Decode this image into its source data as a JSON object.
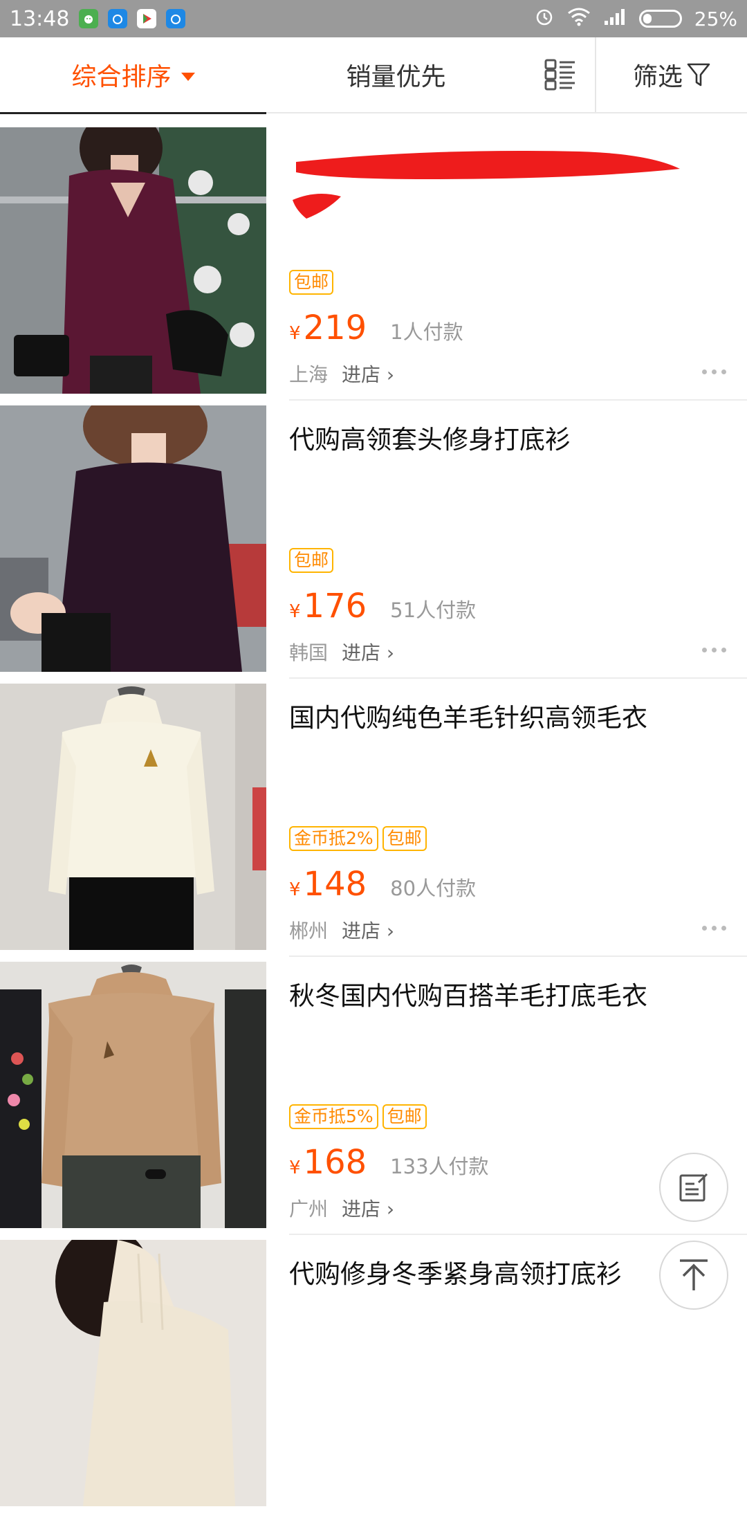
{
  "status_bar": {
    "time": "13:48",
    "battery": "25%"
  },
  "sortbar": {
    "sort_default": "综合排序",
    "sort_sales": "销量优先",
    "filter": "筛选"
  },
  "products": [
    {
      "title": "",
      "tags": [
        "包邮"
      ],
      "currency": "¥",
      "price": "219",
      "sales": "1人付款",
      "city": "上海",
      "enter_shop": "进店",
      "image": "burgundy v-neck sweater"
    },
    {
      "title": "代购高领套头修身打底衫",
      "tags": [
        "包邮"
      ],
      "currency": "¥",
      "price": "176",
      "sales": "51人付款",
      "city": "韩国",
      "enter_shop": "进店",
      "image": "dark purple mock-neck top"
    },
    {
      "title": "国内代购纯色羊毛针织高领毛衣",
      "tags": [
        "金币抵2%",
        "包邮"
      ],
      "currency": "¥",
      "price": "148",
      "sales": "80人付款",
      "city": "郴州",
      "enter_shop": "进店",
      "image": "white turtleneck sweater"
    },
    {
      "title": "秋冬国内代购百搭羊毛打底毛衣",
      "tags": [
        "金币抵5%",
        "包邮"
      ],
      "currency": "¥",
      "price": "168",
      "sales": "133人付款",
      "city": "广州",
      "enter_shop": "进店",
      "image": "camel knit sweater"
    },
    {
      "title": "代购修身冬季紧身高领打底衫",
      "image": "cream ribbed turtleneck"
    }
  ],
  "colors": {
    "accent": "#ff5000",
    "tag": "#ff8a00"
  }
}
